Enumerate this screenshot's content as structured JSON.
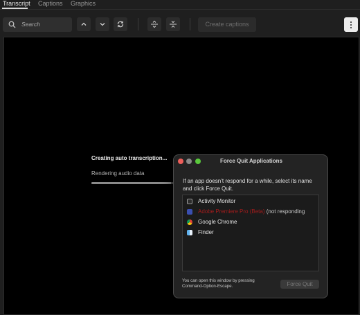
{
  "tabs": [
    {
      "label": "Transcript",
      "active": true
    },
    {
      "label": "Captions",
      "active": false
    },
    {
      "label": "Graphics",
      "active": false
    }
  ],
  "toolbar": {
    "search_placeholder": "Search",
    "prev_icon": "chevron-up-icon",
    "next_icon": "chevron-down-icon",
    "sync_icon": "sync-icon",
    "expand_icon": "expand-icon",
    "collapse_icon": "collapse-icon",
    "create_captions_label": "Create captions",
    "more_icon": "more-vertical-icon"
  },
  "status": {
    "title": "Creating auto transcription...",
    "subtitle": "Rendering audio data",
    "progress": 0.83
  },
  "dialog": {
    "title": "Force Quit Applications",
    "message": "If an app doesn’t respond for a while, select its name and click Force Quit.",
    "apps": [
      {
        "name": "Activity Monitor",
        "icon": "activity-monitor-icon",
        "suffix": ""
      },
      {
        "name": "Adobe Premiere Pro (Beta)",
        "icon": "premiere-pro-icon",
        "suffix": "(not responding",
        "redacted": true
      },
      {
        "name": "Google Chrome",
        "icon": "chrome-icon",
        "suffix": ""
      },
      {
        "name": "Finder",
        "icon": "finder-icon",
        "suffix": ""
      }
    ],
    "note": "You can open this window by pressing Command-Option-Escape.",
    "force_quit_label": "Force Quit"
  },
  "colors": {
    "background": "#1f1f1f",
    "panel": "#000000",
    "dialog": "#232323",
    "close": "#ee5f5b",
    "minimize": "#8a8a8a",
    "zoom": "#5ac83c",
    "not_responding_name": "#a11c1c"
  }
}
